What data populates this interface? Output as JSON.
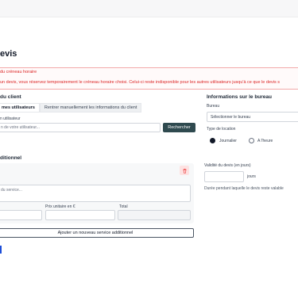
{
  "page": {
    "title": "evis"
  },
  "alert": {
    "title": "du créneau horaire",
    "text": "un devis, vous réservez temporairement le créneau horaire choisi. Celui-ci reste indisponible pour les autres utilisateurs jusqu'à ce que le devis s"
  },
  "client": {
    "section_title": "du client",
    "tabs": [
      "mes utilisateurs",
      "Rentrer manuellement les informations du client"
    ],
    "field_label": "n utilisateur",
    "search_placeholder": "n de votre utilisateur...",
    "search_button": "Rechercher"
  },
  "office": {
    "section_title": "Informations sur le bureau",
    "bureau_label": "Bureau",
    "bureau_placeholder": "Sélectionner le bureau",
    "location_label": "Type de location",
    "options": [
      "Journalier",
      "A l'heure"
    ],
    "selected": "Journalier"
  },
  "additional": {
    "section_title": "ditionnel",
    "description_placeholder": "du service...",
    "columns": [
      "Prix unitaire en €",
      "Total"
    ],
    "add_button": "Ajouter un nouveau service additionnel"
  },
  "validity": {
    "label": "Validité du devis (en jours)",
    "unit": "jours",
    "hint": "Durée pendant laquelle le devis reste valable"
  },
  "colors": {
    "alert": "#dc2626",
    "button": "#2f4a4f",
    "link_accent": "#1d4ed8"
  },
  "icons": {
    "delete": "trash-icon"
  }
}
